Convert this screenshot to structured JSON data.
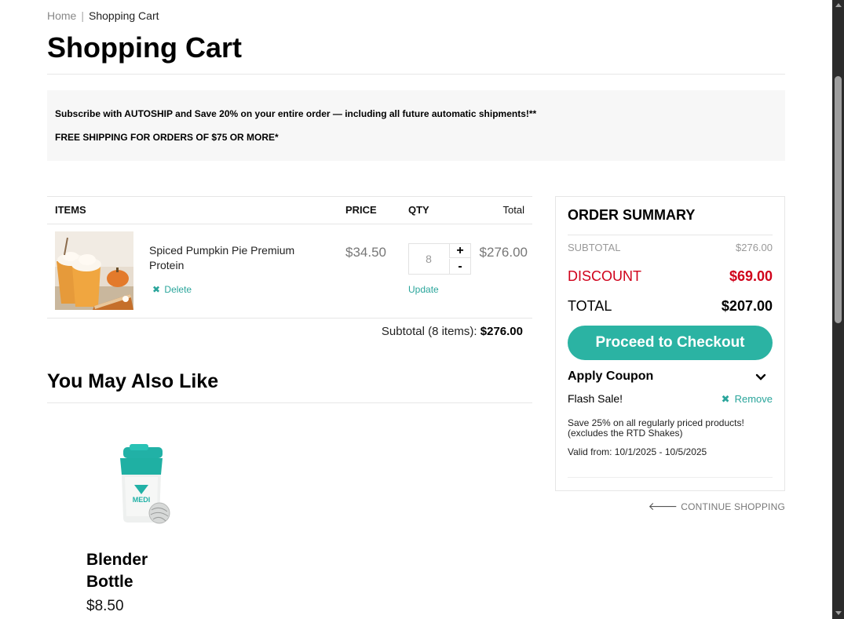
{
  "breadcrumb": {
    "home": "Home",
    "separator": "|",
    "current": "Shopping Cart"
  },
  "page_title": "Shopping Cart",
  "promo": {
    "line1": "Subscribe with AUTOSHIP and Save 20% on your entire order — including all future automatic shipments!**",
    "line2": "FREE SHIPPING FOR ORDERS OF $75 OR MORE*"
  },
  "cart": {
    "headers": {
      "items": "ITEMS",
      "price": "PRICE",
      "qty": "QTY",
      "total": "Total"
    },
    "items": [
      {
        "name": "Spiced Pumpkin Pie Premium Protein",
        "delete_label": "Delete",
        "price": "$34.50",
        "qty": "8",
        "plus": "+",
        "minus": "-",
        "update_label": "Update",
        "total": "$276.00",
        "image": "pumpkin-protein-drink-photo"
      }
    ],
    "subtotal_label": "Subtotal (8 items):",
    "subtotal_value": "$276.00"
  },
  "recommendations": {
    "title": "You May Also Like",
    "products": [
      {
        "name": "Blender Bottle",
        "price": "$8.50",
        "image": "blender-bottle-photo",
        "logo_text": "MEDI"
      }
    ]
  },
  "summary": {
    "title": "ORDER SUMMARY",
    "subtotal_label": "SUBTOTAL",
    "subtotal_value": "$276.00",
    "discount_label": "DISCOUNT",
    "discount_value": "$69.00",
    "total_label": "TOTAL",
    "total_value": "$207.00",
    "checkout_label": "Proceed to Checkout",
    "coupon_label": "Apply Coupon",
    "coupon_name": "Flash Sale!",
    "remove_label": "Remove",
    "coupon_desc": "Save 25% on all regularly priced products! (excludes the RTD Shakes)",
    "coupon_valid": "Valid from: 10/1/2025 - 10/5/2025"
  },
  "continue_label": "CONTINUE SHOPPING",
  "colors": {
    "accent": "#2bb3a3",
    "link": "#2aa59b",
    "discount": "#d0021b",
    "promo_bg": "#f7f7f7"
  }
}
